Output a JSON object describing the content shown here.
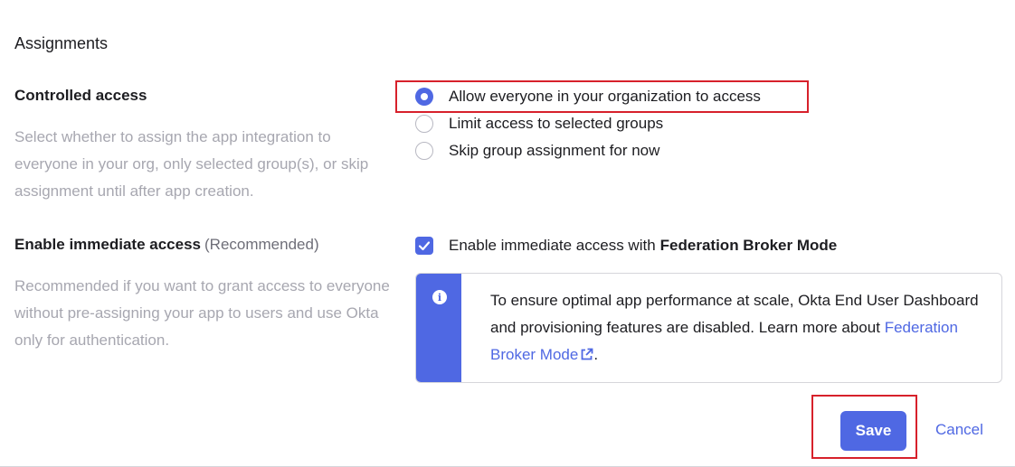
{
  "section": {
    "title": "Assignments"
  },
  "controlled_access": {
    "label": "Controlled access",
    "description": "Select whether to assign the app integration to everyone in your org, only selected group(s), or skip assignment until after app creation.",
    "options": [
      {
        "label": "Allow everyone in your organization to access",
        "selected": true
      },
      {
        "label": "Limit access to selected groups",
        "selected": false
      },
      {
        "label": "Skip group assignment for now",
        "selected": false
      }
    ]
  },
  "immediate_access": {
    "label": "Enable immediate access",
    "label_suffix": "(Recommended)",
    "description": "Recommended if you want to grant access to everyone without pre-assigning your app to users and use Okta only for authentication.",
    "checkbox_label": "Enable immediate access with",
    "checkbox_label_bold": "Federation Broker Mode",
    "checked": true
  },
  "callout": {
    "icon": "info-icon",
    "text_before": "To ensure optimal app performance at scale, Okta End User Dashboard and provisioning features are disabled. Learn more about",
    "link_text": "Federation Broker Mode",
    "text_after": "."
  },
  "actions": {
    "save_label": "Save",
    "cancel_label": "Cancel"
  },
  "colors": {
    "accent": "#4f68e3",
    "highlight": "#d7212b",
    "muted_text": "#a7a7b0"
  }
}
